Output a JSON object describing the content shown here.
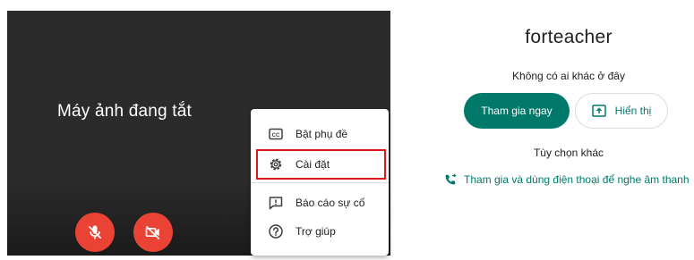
{
  "preview": {
    "camera_off_text": "Máy ảnh đang tắt",
    "mic_button_icon": "mic-off-icon",
    "camera_button_icon": "videocam-off-icon"
  },
  "menu": {
    "items": [
      {
        "label": "Bật phụ đề",
        "icon": "captions-icon"
      },
      {
        "label": "Cài đặt",
        "icon": "settings-gear-icon"
      },
      {
        "label": "Báo cáo sự cố",
        "icon": "report-problem-icon"
      },
      {
        "label": "Trợ giúp",
        "icon": "help-icon"
      }
    ],
    "highlighted_item": "Cài đặt"
  },
  "meeting": {
    "title": "forteacher",
    "status": "Không có ai khác ở đây",
    "join_label": "Tham gia ngay",
    "present_label": "Hiển thị",
    "other_options": "Tùy chọn khác",
    "phone_join_label": "Tham gia và dùng điện thoại để nghe âm thanh"
  },
  "colors": {
    "accent": "#00796b",
    "danger": "#ea4335",
    "highlight_border": "#e0141e",
    "preview_bg": "#2b2b2b"
  }
}
